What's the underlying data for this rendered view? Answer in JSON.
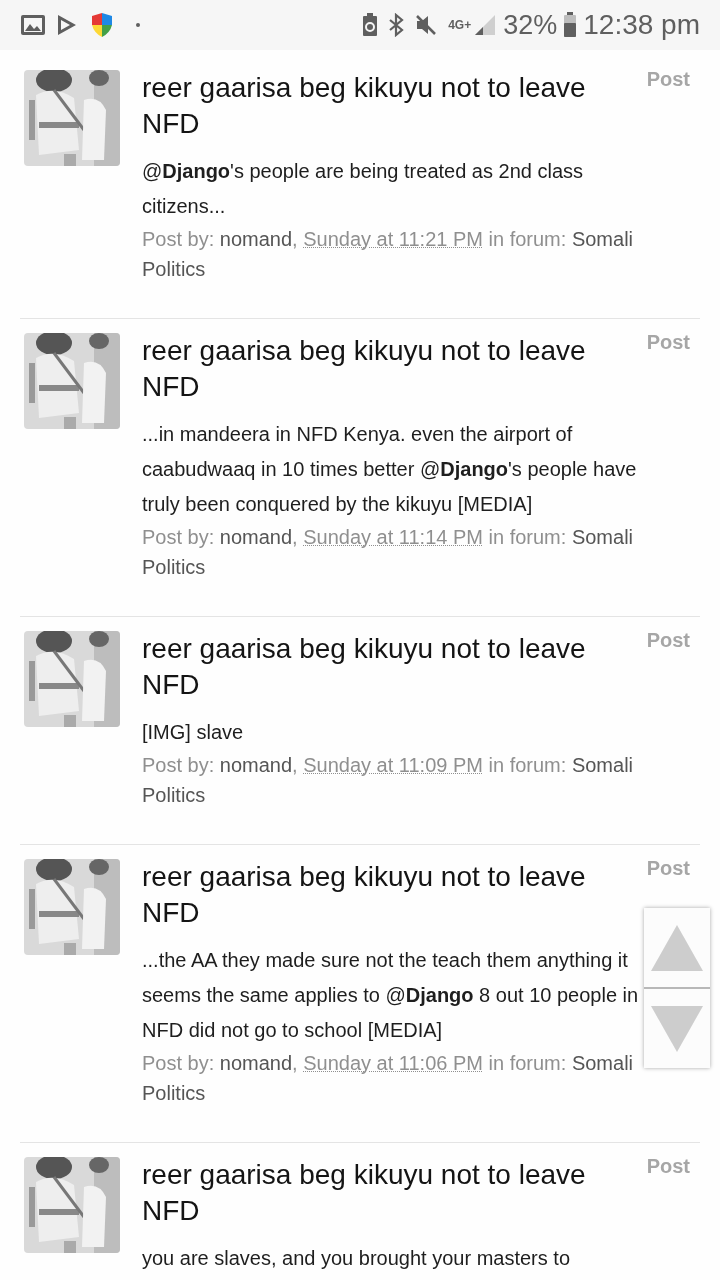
{
  "status_bar": {
    "network": "4G+",
    "battery": "32%",
    "time": "12:38 pm"
  },
  "posts": [
    {
      "title": "reer gaarisa beg kikuyu not to leave NFD",
      "tag": "Post",
      "snippet": "@**Django**'s people are being treated as 2nd class citizens...",
      "by_label": "Post by:",
      "author": "nomand",
      "separator": ",",
      "date": "Sunday at 11:21 PM",
      "forum_label": "in forum:",
      "forum": "Somali Politics"
    },
    {
      "title": "reer gaarisa beg kikuyu not to leave NFD",
      "tag": "Post",
      "snippet": "...in mandeera in NFD Kenya. even the airport of caabudwaaq in 10 times better @**Django**'s people have truly been conquered by the kikuyu [MEDIA]",
      "by_label": "Post by:",
      "author": "nomand",
      "separator": ",",
      "date": "Sunday at 11:14 PM",
      "forum_label": "in forum:",
      "forum": "Somali Politics"
    },
    {
      "title": "reer gaarisa beg kikuyu not to leave NFD",
      "tag": "Post",
      "snippet": "[IMG] slave",
      "by_label": "Post by:",
      "author": "nomand",
      "separator": ",",
      "date": "Sunday at 11:09 PM",
      "forum_label": "in forum:",
      "forum": "Somali Politics"
    },
    {
      "title": "reer gaarisa beg kikuyu not to leave NFD",
      "tag": "Post",
      "snippet": "...the AA they made sure not the teach them anything it seems the same applies to @**Django** 8 out 10 people in NFD did not go to school [MEDIA]",
      "by_label": "Post by:",
      "author": "nomand",
      "separator": ",",
      "date": "Sunday at 11:06 PM",
      "forum_label": "in forum:",
      "forum": "Somali Politics"
    },
    {
      "title": "reer gaarisa beg kikuyu not to leave NFD",
      "tag": "Post",
      "snippet": "you are slaves, and you brought your masters to"
    }
  ]
}
